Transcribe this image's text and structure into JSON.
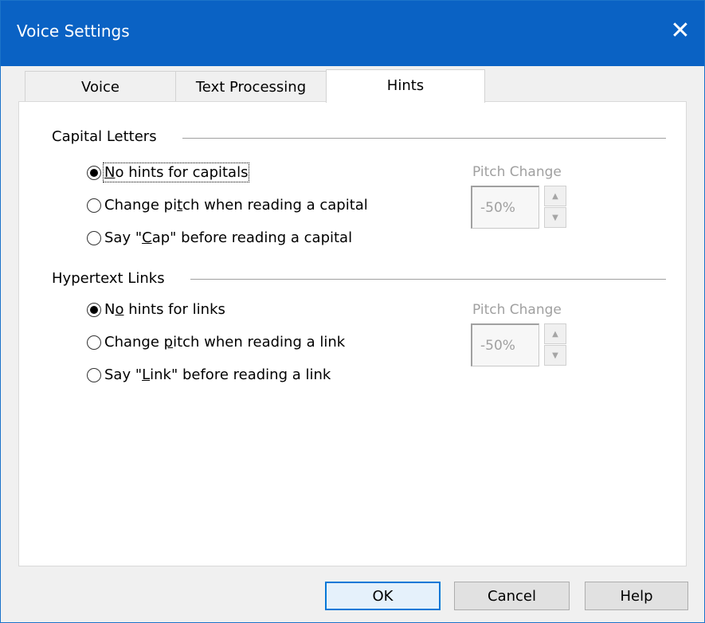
{
  "window": {
    "title": "Voice Settings"
  },
  "tabs": [
    {
      "label": "Voice"
    },
    {
      "label": "Text Processing"
    },
    {
      "label": "Hints",
      "active": true
    }
  ],
  "capital_letters": {
    "title": "Capital Letters",
    "options": [
      {
        "pre": "",
        "acc": "N",
        "post": "o hints for capitals",
        "selected": true
      },
      {
        "pre": "Change pi",
        "acc": "t",
        "post": "ch when reading a capital",
        "selected": false
      },
      {
        "pre": "Say \"",
        "acc": "C",
        "post": "ap\" before reading a capital",
        "selected": false
      }
    ],
    "pitch_label": "Pitch Change",
    "pitch_value": "-50%"
  },
  "hypertext_links": {
    "title": "Hypertext Links",
    "options": [
      {
        "pre": "N",
        "acc": "o",
        "post": " hints for links",
        "selected": true
      },
      {
        "pre": "Change ",
        "acc": "p",
        "post": "itch when reading a link",
        "selected": false
      },
      {
        "pre": "Say \"",
        "acc": "L",
        "post": "ink\" before reading a link",
        "selected": false
      }
    ],
    "pitch_label": "Pitch Change",
    "pitch_value": "-50%"
  },
  "buttons": {
    "ok": "OK",
    "cancel": "Cancel",
    "help": "Help"
  },
  "colors": {
    "titlebar": "#0a62c4",
    "accent": "#0078d7"
  },
  "icons": {
    "close": "close-icon",
    "spin_up": "arrow-up-icon",
    "spin_down": "arrow-down-icon"
  }
}
